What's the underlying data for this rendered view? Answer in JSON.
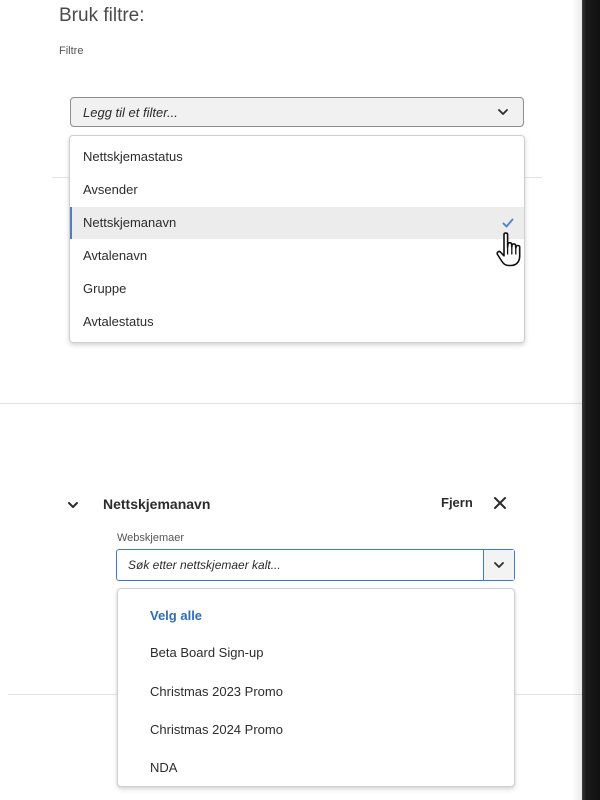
{
  "header": {
    "title": "Bruk filtre:",
    "subtitle": "Filtre"
  },
  "filter_select": {
    "placeholder": "Legg til et filter...",
    "options": [
      {
        "label": "Nettskjemastatus",
        "selected": false
      },
      {
        "label": "Avsender",
        "selected": false
      },
      {
        "label": "Nettskjemanavn",
        "selected": true
      },
      {
        "label": "Avtalenavn",
        "selected": false
      },
      {
        "label": "Gruppe",
        "selected": false
      },
      {
        "label": "Avtalestatus",
        "selected": false
      }
    ]
  },
  "active_filter": {
    "title": "Nettskjemanavn",
    "remove_label": "Fjern",
    "field_label": "Webskjemaer",
    "search_placeholder": "Søk etter nettskjemaer kalt...",
    "options": [
      {
        "label": "Velg alle",
        "kind": "select-all"
      },
      {
        "label": "Beta Board Sign-up"
      },
      {
        "label": "Christmas 2023 Promo"
      },
      {
        "label": "Christmas 2024 Promo"
      },
      {
        "label": "NDA"
      }
    ]
  },
  "colors": {
    "accent": "#4a7fc9",
    "select_all": "#2e6cc0",
    "selected_row_bg": "#ececec"
  },
  "icons": {
    "dropdown": "chevron-down-icon",
    "selected": "checkmark-icon",
    "collapse": "chevron-down-icon",
    "remove": "close-icon",
    "pointer": "hand-cursor-icon"
  }
}
